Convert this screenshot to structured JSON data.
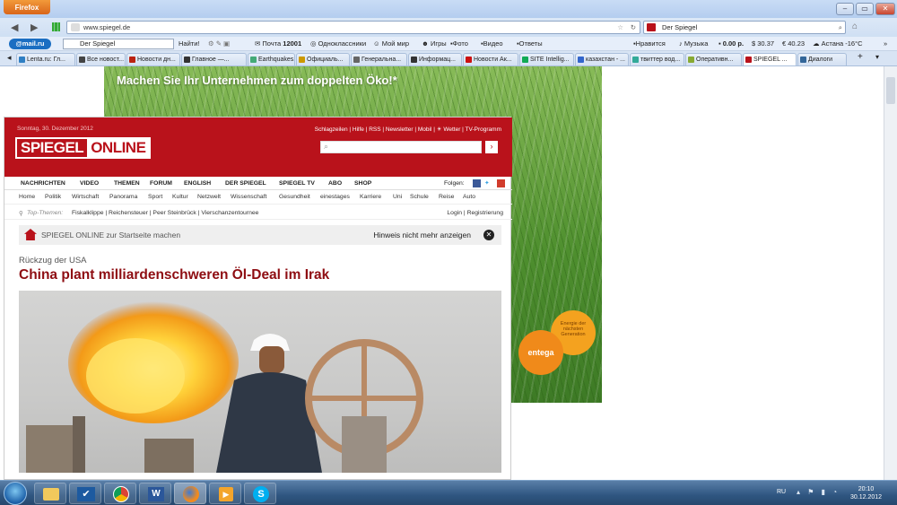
{
  "browser": {
    "menu_button": "Firefox",
    "url": "www.spiegel.de",
    "search_value": "Der Spiegel"
  },
  "toolbar": {
    "brand": "@mail.ru",
    "search_value": "Der Spiegel",
    "find_label": "Найти!",
    "items": [
      "Почта",
      "Одноклассники",
      "Мой мир",
      "Игры",
      "Фото",
      "Видео",
      "Ответы",
      "Нравится",
      "Музыка"
    ],
    "mail_count": "12001",
    "balance": "0.00 р.",
    "usd": "30.37",
    "eur": "40.23",
    "weather": "Астана -16°C"
  },
  "tabs": [
    {
      "label": "Lenta.ru: Гл...",
      "color": "#2f7fc3"
    },
    {
      "label": "Все новост...",
      "color": "#444"
    },
    {
      "label": "Новости дн...",
      "color": "#b21"
    },
    {
      "label": "Главное —...",
      "color": "#333"
    },
    {
      "label": "Earthquakes...",
      "color": "#4a7"
    },
    {
      "label": "Официаль...",
      "color": "#c90"
    },
    {
      "label": "Генеральна...",
      "color": "#666"
    },
    {
      "label": "Информац...",
      "color": "#333"
    },
    {
      "label": "Новости Ак...",
      "color": "#c11"
    },
    {
      "label": "SITE Intellig...",
      "color": "#1a5"
    },
    {
      "label": "казахстан - ...",
      "color": "#36c"
    },
    {
      "label": "твиттер вод...",
      "color": "#3a9"
    },
    {
      "label": "Оперативн...",
      "color": "#8a3"
    },
    {
      "label": "SPIEGEL ...",
      "color": "#b9121b"
    },
    {
      "label": "Диалоги",
      "color": "#369"
    }
  ],
  "ad": {
    "headline": "Machen Sie Ihr Unternehmen zum doppelten Öko!*",
    "badge_text": "Energie der nächsten Generation",
    "brand": "entega"
  },
  "spiegel": {
    "date": "Sonntag, 30. Dezember 2012",
    "top_links": "Schlagzeilen | Hilfe | RSS | Newsletter | Mobil | ☀ Wetter | TV-Programm",
    "logo_left": "SPIEGEL",
    "logo_right": "ONLINE",
    "nav": [
      "NACHRICHTEN",
      "VIDEO",
      "THEMEN",
      "FORUM",
      "ENGLISH",
      "DER SPIEGEL",
      "SPIEGEL TV",
      "ABO",
      "SHOP"
    ],
    "follow_label": "Folgen:",
    "sub_nav": [
      "Home",
      "Politik",
      "Wirtschaft",
      "Panorama",
      "Sport",
      "Kultur",
      "Netzwelt",
      "Wissenschaft",
      "Gesundheit",
      "einestages",
      "Karriere",
      "Uni",
      "Schule",
      "Reise",
      "Auto"
    ],
    "top_themes_label": "Top-Themen:",
    "top_themes": "Fiskalklippe | Reichensteuer | Peer Steinbrück | Vierschanzentournee",
    "login": "Login | Registrierung",
    "homepage_prompt": "SPIEGEL ONLINE zur Startseite machen",
    "dismiss_label": "Hinweis nicht mehr anzeigen",
    "kicker": "Rückzug der USA",
    "headline": "China plant milliardenschweren Öl-Deal im Irak",
    "brand_color": "#b9121b",
    "headline_color": "#8e0d12"
  },
  "taskbar": {
    "lang": "RU",
    "time": "20:10",
    "date": "30.12.2012"
  }
}
